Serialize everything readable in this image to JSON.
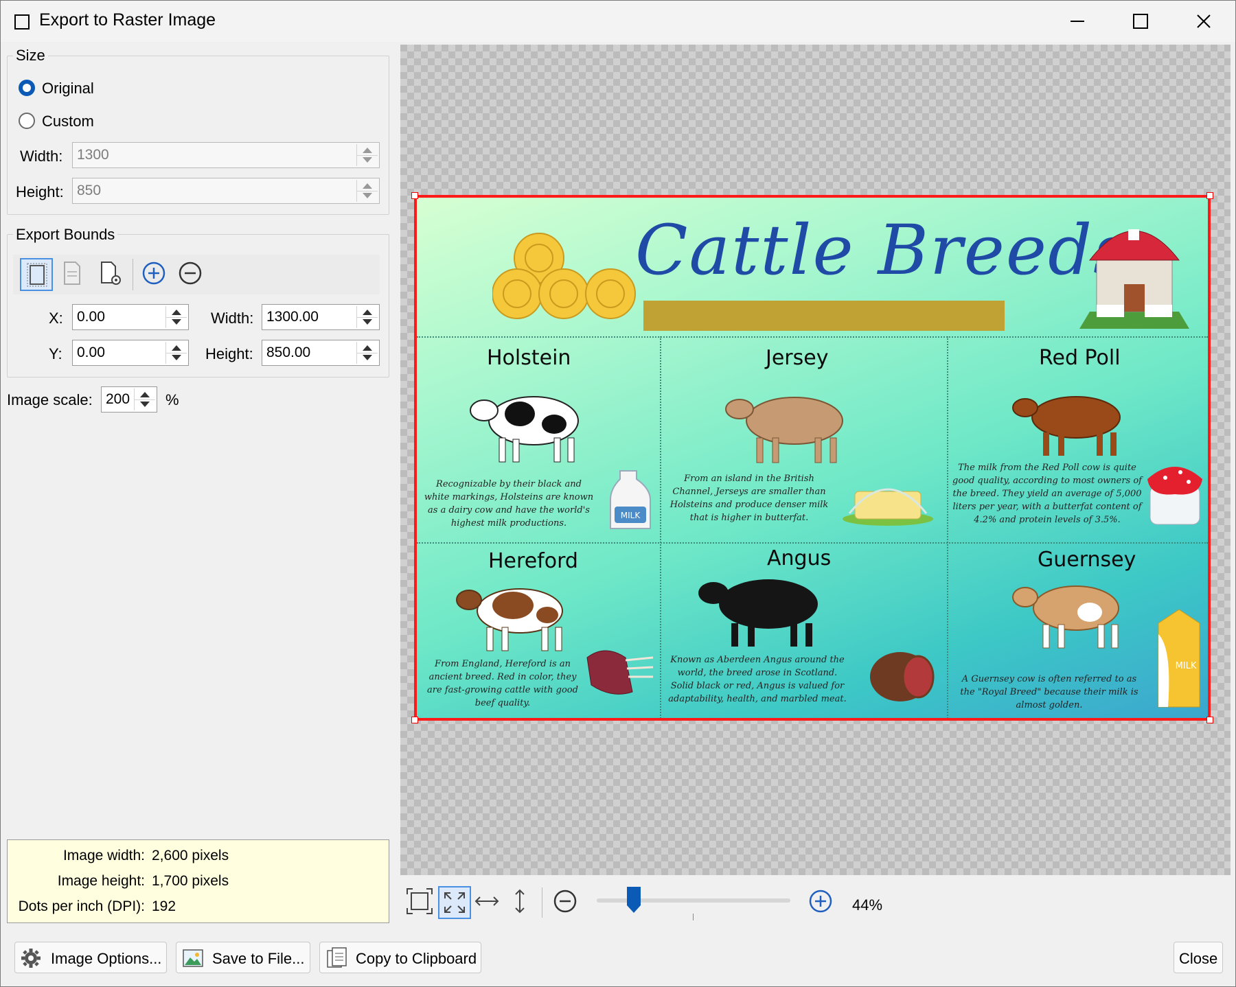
{
  "window": {
    "title": "Export to Raster Image"
  },
  "size": {
    "group_label": "Size",
    "original_label": "Original",
    "custom_label": "Custom",
    "selected": "Original",
    "width_label": "Width:",
    "width_value": "1300",
    "height_label": "Height:",
    "height_value": "850"
  },
  "bounds": {
    "group_label": "Export Bounds",
    "x_label": "X:",
    "x_value": "0.00",
    "y_label": "Y:",
    "y_value": "0.00",
    "width_label": "Width:",
    "width_value": "1300.00",
    "height_label": "Height:",
    "height_value": "850.00"
  },
  "scale": {
    "label": "Image scale:",
    "value": "200",
    "unit": "%"
  },
  "info": {
    "width_label": "Image width:",
    "width_value": "2,600 pixels",
    "height_label": "Image height:",
    "height_value": "1,700 pixels",
    "dpi_label": "Dots per inch (DPI):",
    "dpi_value": "192"
  },
  "buttons": {
    "image_options": "Image Options...",
    "save_to_file": "Save to File...",
    "copy_to_clipboard": "Copy to Clipboard",
    "close": "Close"
  },
  "zoom": {
    "value": "44%",
    "level": 0.19
  },
  "poster": {
    "title": "Cattle Breeds",
    "breeds": [
      {
        "name": "Holstein",
        "desc": "Recognizable by their black and white markings, Holsteins are known as a dairy cow and have the world's highest milk productions.",
        "product_label": "MILK"
      },
      {
        "name": "Jersey",
        "desc": "From an island in the British Channel, Jerseys are smaller than Holsteins and produce denser milk that is higher in butterfat."
      },
      {
        "name": "Red Poll",
        "desc": "The milk from the Red Poll cow is quite good quality, according to most owners of the breed. They yield an average of 5,000 liters per year, with a butterfat content of 4.2% and protein levels of 3.5%."
      },
      {
        "name": "Hereford",
        "desc": "From England, Hereford is an ancient breed. Red in color, they are fast-growing cattle with good beef quality."
      },
      {
        "name": "Angus",
        "desc": "Known as Aberdeen Angus around the world, the breed arose in Scotland. Solid black or red, Angus is valued for adaptability, health, and marbled meat."
      },
      {
        "name": "Guernsey",
        "desc": "A Guernsey cow is often referred to as the \"Royal Breed\" because their milk is almost golden.",
        "product_label": "MILK"
      }
    ]
  },
  "colors": {
    "accent": "#0a5ab6",
    "selection_border": "#ff1a1a",
    "info_bg": "#ffffdf"
  }
}
